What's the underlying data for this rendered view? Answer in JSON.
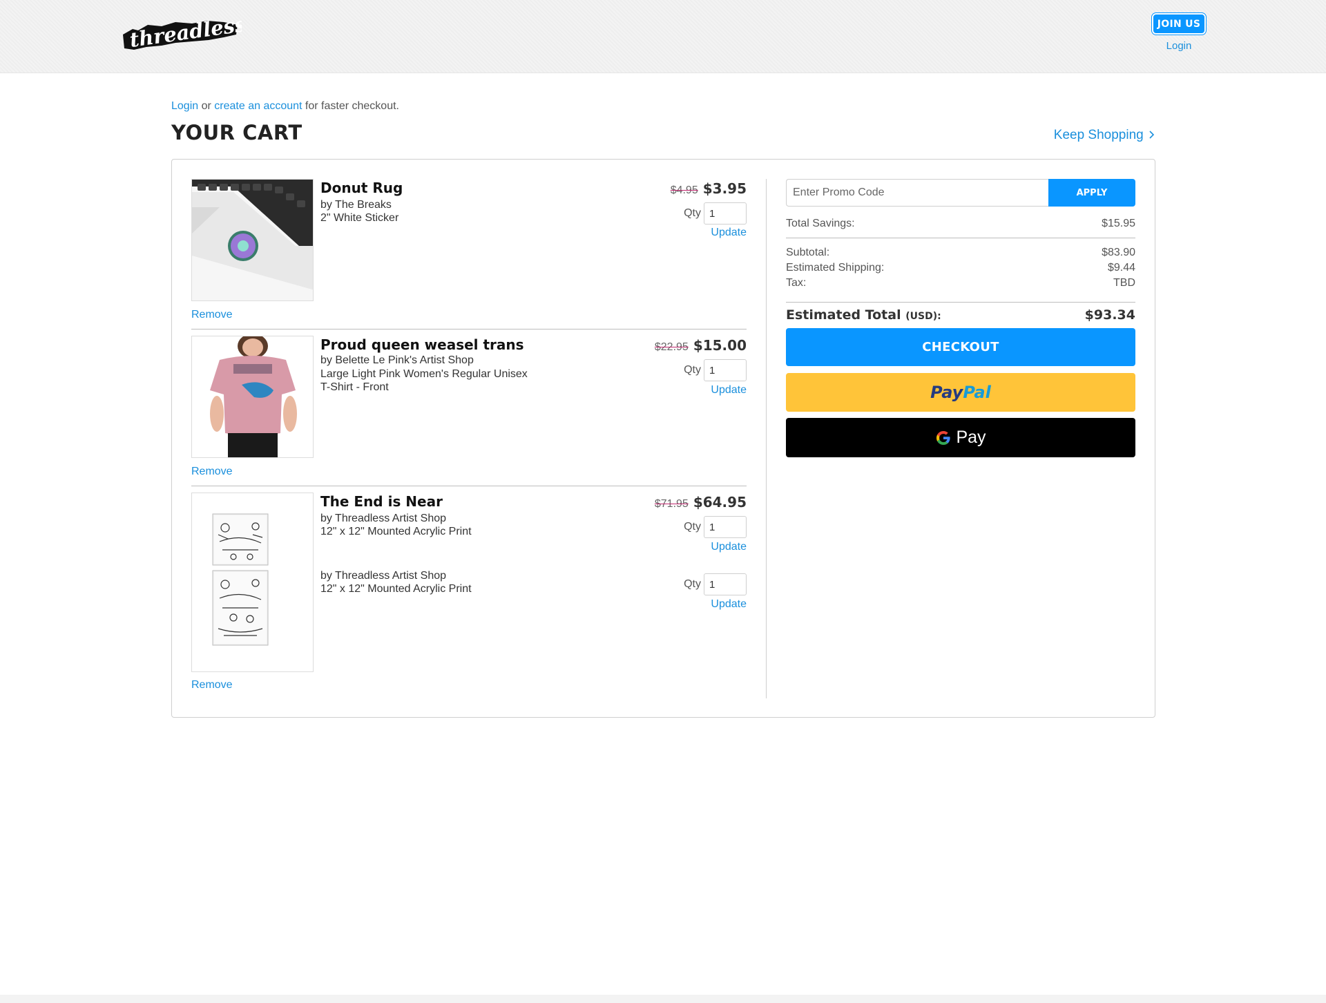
{
  "header": {
    "brand": "threadless",
    "join_label": "JOIN US",
    "login_label": "Login"
  },
  "intro": {
    "login_link": "Login",
    "or_text": " or ",
    "create_link": "create an account",
    "suffix": " for faster checkout."
  },
  "page_title": "YOUR CART",
  "keep_shopping": "Keep Shopping",
  "items": [
    {
      "name": "Donut Rug",
      "artist": "by The Breaks",
      "detail1": "2\" White Sticker",
      "old_price": "$4.95",
      "price": "$3.95",
      "qty_label": "Qty",
      "qty": "1",
      "update_label": "Update",
      "remove_label": "Remove"
    },
    {
      "name": "Proud queen weasel trans",
      "artist": "by Belette Le Pink's Artist Shop",
      "detail1": "Large Light Pink Women's Regular Unisex",
      "detail2": "T-Shirt - Front",
      "old_price": "$22.95",
      "price": "$15.00",
      "qty_label": "Qty",
      "qty": "1",
      "update_label": "Update",
      "remove_label": "Remove"
    },
    {
      "name": "The End is Near",
      "artist": "by Threadless Artist Shop",
      "detail1": "12\" x 12\" Mounted Acrylic Print",
      "artist_b": "by Threadless Artist Shop",
      "detail1_b": "12\" x 12\" Mounted Acrylic Print",
      "old_price": "$71.95",
      "price": "$64.95",
      "qty_label": "Qty",
      "qty": "1",
      "qty_b": "1",
      "update_label": "Update",
      "remove_label": "Remove"
    }
  ],
  "summary": {
    "promo_placeholder": "Enter Promo Code",
    "apply_label": "APPLY",
    "savings_label": "Total Savings:",
    "savings_value": "$15.95",
    "subtotal_label": "Subtotal:",
    "subtotal_value": "$83.90",
    "shipping_label": "Estimated Shipping:",
    "shipping_value": "$9.44",
    "tax_label": "Tax:",
    "tax_value": "TBD",
    "total_label": "Estimated Total",
    "total_unit": "(USD):",
    "total_value": "$93.34",
    "checkout_label": "CHECKOUT",
    "paypal_a": "Pay",
    "paypal_b": "Pal",
    "gpay_label": "Pay"
  },
  "colors": {
    "accent": "#0a96ff",
    "link": "#1a8fdc",
    "paypal_yellow": "#ffc439",
    "strike": "#c0266d"
  },
  "icons": {
    "logo": "threadless-logo",
    "keep_shopping": "chevron-right-icon",
    "gpay": "google-g-icon"
  }
}
